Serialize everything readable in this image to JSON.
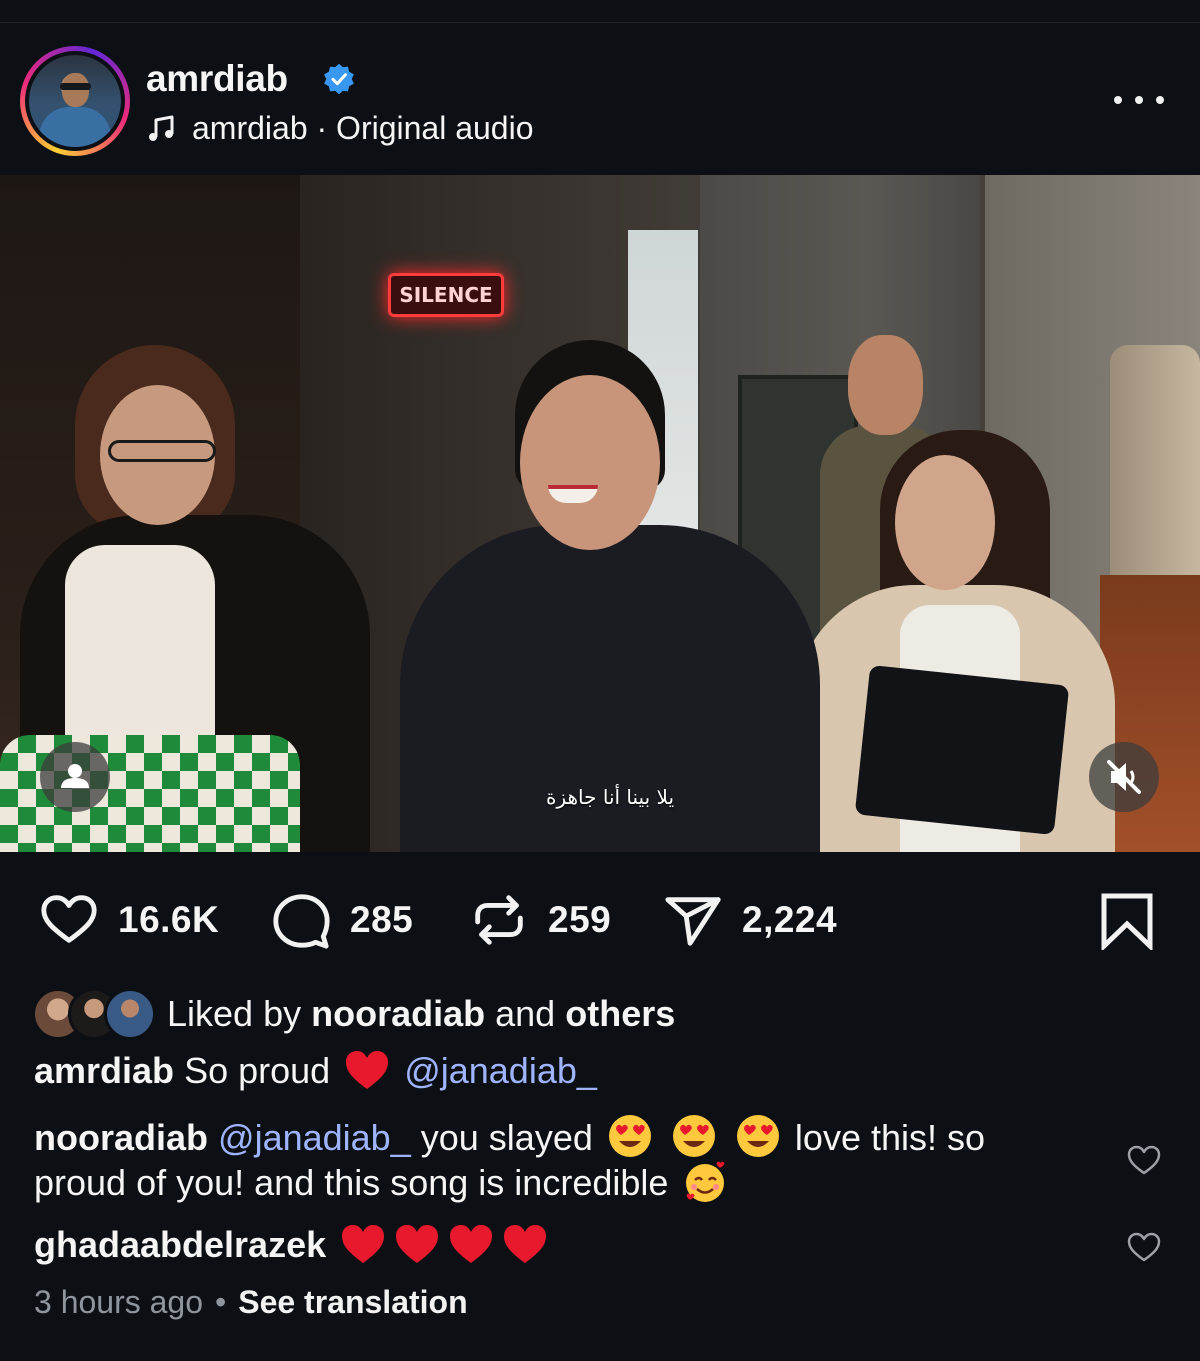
{
  "header": {
    "username": "amrdiab",
    "verified": true,
    "audio_icon": "music-note-icon",
    "audio_label": "amrdiab · Original audio",
    "more_icon": "more-options-icon"
  },
  "media": {
    "sign_text": "SILENCE",
    "subtitle": "يلا بينا أنا جاهزة",
    "tag_icon": "user-tag-icon",
    "mute_icon": "muted-speaker-icon"
  },
  "actions": {
    "likes": "16.6K",
    "comments": "285",
    "reposts": "259",
    "shares": "2,224"
  },
  "liked_by": {
    "prefix": "Liked by",
    "user": "nooradiab",
    "middle": "and",
    "suffix": "others"
  },
  "caption": {
    "user": "amrdiab",
    "text": "So proud",
    "mention": "@janadiab_"
  },
  "comments": [
    {
      "user": "nooradiab",
      "mention": "@janadiab_",
      "text_before": "you slayed",
      "text_after": "love this! so",
      "text_line2": "proud of you! and this song is incredible"
    },
    {
      "user": "ghadaabdelrazek"
    }
  ],
  "meta": {
    "time": "3 hours ago",
    "separator": "•",
    "see_translation": "See translation"
  },
  "colors": {
    "background": "#0c0f14",
    "verified_blue": "#3897f0",
    "mention": "#9fb4ff",
    "heart_red": "#e8192c"
  }
}
